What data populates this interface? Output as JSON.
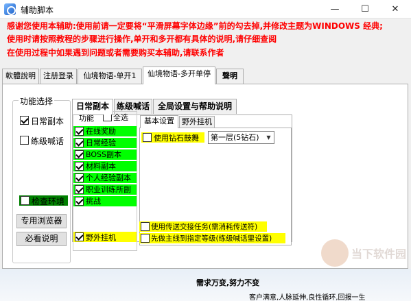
{
  "window": {
    "title": "辅助脚本",
    "min": "—",
    "max": "☐",
    "close": "✕"
  },
  "notices": [
    "感谢您使用本辅助:使用前请一定要将“平滑屏幕字体边缘”前的勾去掉,并修改主题为WINDOWS 经典;",
    "使用时请按照教程的步骤进行操作,单开和多开都有具体的说明,请仔细查阅",
    "在使用过程中如果遇到问题或者需要购买本辅助,请联系作者"
  ],
  "top_tabs": [
    "軟體說明",
    "注册登录",
    "仙境物语-单开1",
    "仙境物语-多开单停",
    "聲明"
  ],
  "left_group": {
    "title": "功能选择",
    "daily": "日常副本",
    "shout": "练级喊话",
    "check_env": "检查环境",
    "browser_btn": "专用浏览器",
    "readme_btn": "必看说明"
  },
  "inner_tabs": [
    "日常副本",
    "练级喊话",
    "全局设置与帮助说明"
  ],
  "func_group": {
    "title": "功能",
    "select_all": "全选",
    "items": [
      "在线奖励",
      "日常经验",
      "BOSS副本",
      "材料副本",
      "个人经验副本",
      "职业训练所副",
      "挑战"
    ],
    "outdoor": "野外挂机"
  },
  "sub_tabs": [
    "基本设置",
    "野外挂机"
  ],
  "settings": {
    "use_diamond": "使用钻石鼓舞",
    "diamond_option": "第一层(5钻石)",
    "teleport_task": "使用传送交接任务(需消耗传送符)",
    "main_line": "先做主线到指定等级(练级喊话里设置)"
  },
  "footer": {
    "line1": "需求万变,努力不变",
    "line2": "客户满意,人脉延伸,良性循环,回报一生"
  },
  "watermark": "当下软件园"
}
